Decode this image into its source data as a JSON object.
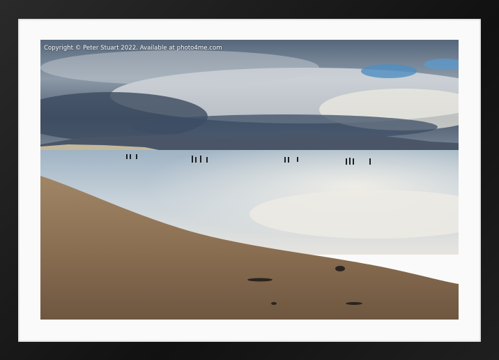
{
  "image": {
    "subject": "framed-print",
    "copyright": "Copyright © Peter Stuart 2022. Available at photo4me.com"
  },
  "colors": {
    "frame": "#1c1c1c",
    "mount": "#fafafa",
    "sky_dark": "#3a4a5e",
    "sky_light": "#d8dde2",
    "sea": "#b9c8d4",
    "sand": "#8a6d4f"
  }
}
